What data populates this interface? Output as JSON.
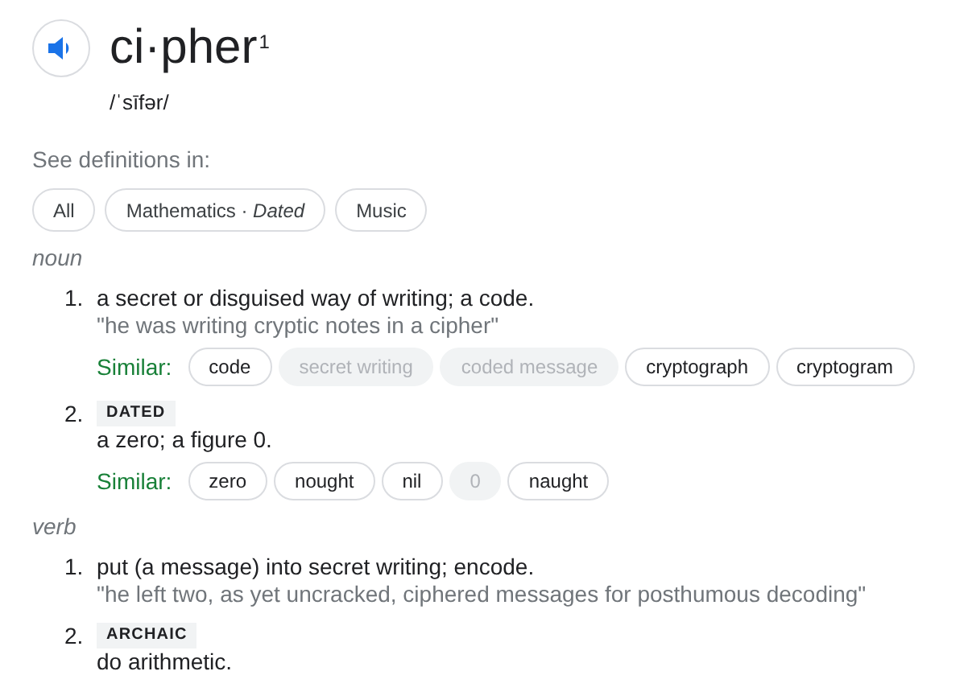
{
  "headword": {
    "word": "ci·pher",
    "superscript": "1",
    "phonetic": "/ˈsīfər/"
  },
  "see_definitions": {
    "label": "See definitions in:",
    "chips": [
      {
        "label": "All"
      },
      {
        "label": "Mathematics · *Dated*"
      },
      {
        "label": "Music"
      }
    ]
  },
  "senses": [
    {
      "part_of_speech": "noun",
      "definitions": [
        {
          "number": "1.",
          "text": "a secret or disguised way of writing; a code.",
          "example": "\"he was writing cryptic notes in a cipher\"",
          "similar_label": "Similar:",
          "similar": [
            {
              "label": "code",
              "disabled": false
            },
            {
              "label": "secret writing",
              "disabled": true
            },
            {
              "label": "coded message",
              "disabled": true
            },
            {
              "label": "cryptograph",
              "disabled": false
            },
            {
              "label": "cryptogram",
              "disabled": false
            }
          ]
        },
        {
          "number": "2.",
          "tag": "DATED",
          "text": "a zero; a figure 0.",
          "similar_label": "Similar:",
          "similar": [
            {
              "label": "zero",
              "disabled": false
            },
            {
              "label": "nought",
              "disabled": false
            },
            {
              "label": "nil",
              "disabled": false
            },
            {
              "label": "0",
              "disabled": true
            },
            {
              "label": "naught",
              "disabled": false
            }
          ]
        }
      ]
    },
    {
      "part_of_speech": "verb",
      "definitions": [
        {
          "number": "1.",
          "text": "put (a message) into secret writing; encode.",
          "example": "\"he left two, as yet uncracked, ciphered messages for posthumous decoding\""
        },
        {
          "number": "2.",
          "tag": "ARCHAIC",
          "text": "do arithmetic."
        }
      ]
    }
  ]
}
